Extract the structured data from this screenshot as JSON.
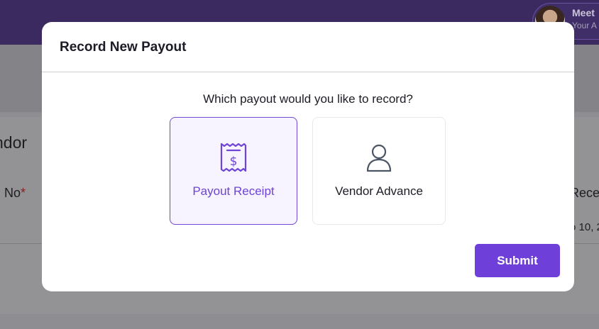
{
  "background": {
    "user": {
      "name": "Meet",
      "subtitle": "Your A"
    },
    "heading": "ndor",
    "field_label": "No",
    "required_mark": "*",
    "right_label": "Receipt",
    "right_value": "o 10, 2"
  },
  "modal": {
    "title": "Record New Payout",
    "question": "Which payout would you like to record?",
    "options": [
      {
        "label": "Payout Receipt",
        "icon": "receipt-dollar-icon",
        "selected": true
      },
      {
        "label": "Vendor Advance",
        "icon": "user-icon",
        "selected": false
      }
    ],
    "submit_label": "Submit"
  },
  "colors": {
    "accent": "#6f3fd9",
    "selected_bg": "#f7f3ff",
    "topbar": "#3a2a60"
  }
}
